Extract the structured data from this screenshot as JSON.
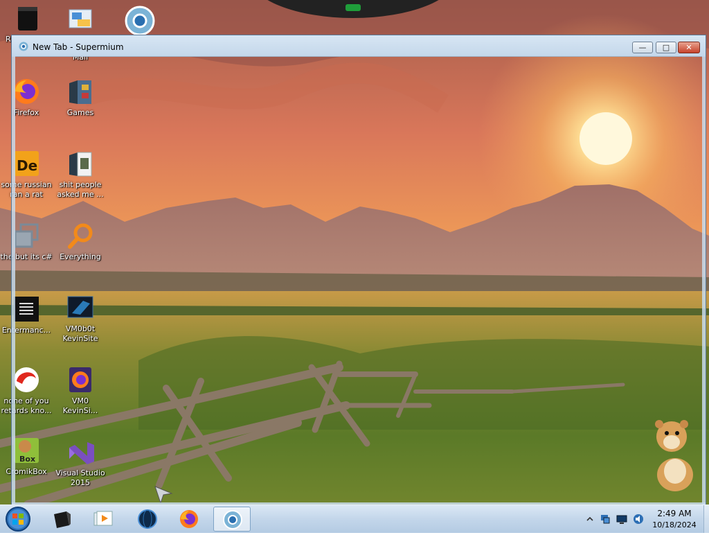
{
  "desktop": {
    "icons_col0": [
      {
        "label": "R",
        "icon": "recycle-bin-icon"
      },
      {
        "label": "Firefox",
        "icon": "firefox-icon"
      },
      {
        "label": "some russian\nran a rat",
        "icon": "de-app-icon"
      },
      {
        "label": "the but its c#",
        "icon": "copy-windows-icon"
      },
      {
        "label": "Entermanc...",
        "icon": "terminal-icon"
      },
      {
        "label": "none of you\nretards kno...",
        "icon": "red-creature-icon"
      },
      {
        "label": "CromikBox",
        "icon": "hamster-box-icon"
      }
    ],
    "icons_col1": [
      {
        "label": "Mail",
        "icon": "mail-icon"
      },
      {
        "label": "Games",
        "icon": "games-folder-icon"
      },
      {
        "label": "shit people\nasked me ...",
        "icon": "folder-icon"
      },
      {
        "label": "Everything",
        "icon": "search-magnifier-icon"
      },
      {
        "label": "VM0b0t\nKevinSite",
        "icon": "vm-icon"
      },
      {
        "label": "VM0\nKevinSi...",
        "icon": "firefox-dev-icon"
      },
      {
        "label": "Visual Studio\n2015",
        "icon": "visual-studio-icon"
      }
    ],
    "icons_top": [
      {
        "label": "",
        "icon": "chrome-icon"
      }
    ]
  },
  "window": {
    "title": "New Tab - Supermium",
    "app_icon": "supermium-icon",
    "controls": {
      "minimize": "—",
      "maximize": "□",
      "close": "✕"
    }
  },
  "taskbar": {
    "start": "windows-start-orb",
    "pinned": [
      "terminal-icon",
      "media-player-icon",
      "globe-icon",
      "firefox-icon",
      "supermium-icon"
    ],
    "active_index": 4,
    "tray": {
      "time": "2:49 AM",
      "date": "10/18/2024",
      "icons": [
        "chevron-up-icon",
        "network-icon",
        "monitor-icon",
        "speaker-icon"
      ]
    }
  },
  "colors": {
    "sky_top": "#b86a4e",
    "sky_mid": "#e88a4a",
    "sun": "#fff4c0",
    "mountains": "#9a6c66",
    "meadow": "#6b8a2e",
    "taskbar": "#c3d6ea"
  }
}
